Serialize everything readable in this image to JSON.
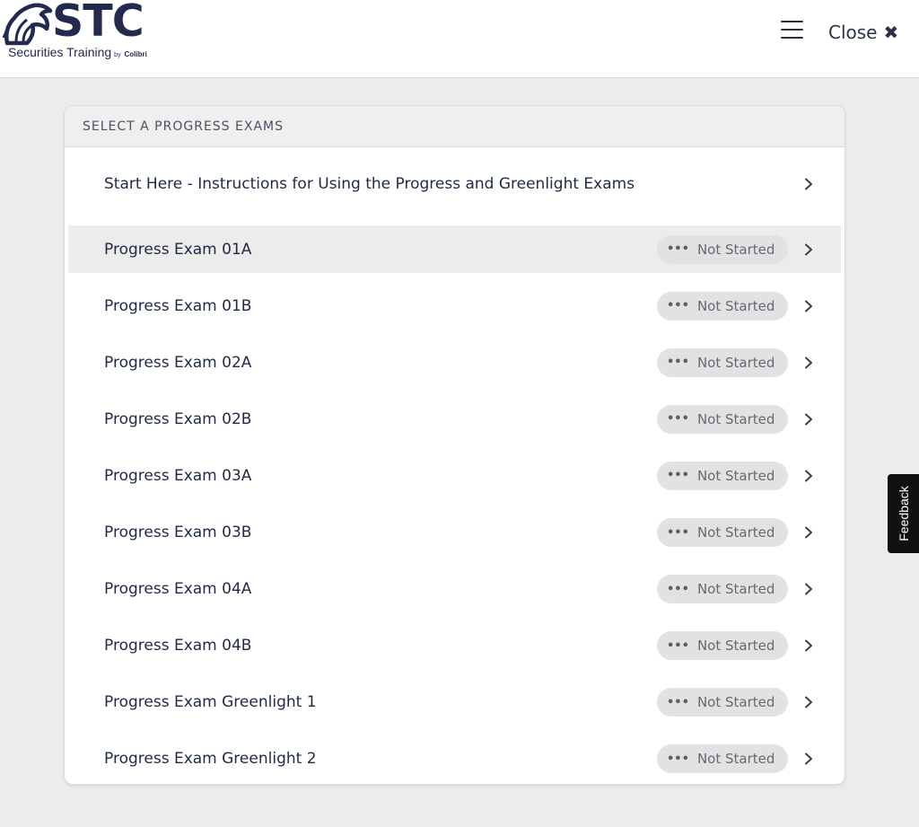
{
  "header": {
    "logo_text": "STC",
    "logo_tagline": "Securities Training",
    "logo_by": "by",
    "logo_brand": "Colibri",
    "menu_icon": "hamburger-menu-icon",
    "close_label": "Close",
    "close_icon": "✖"
  },
  "panel": {
    "title": "SELECT A PROGRESS EXAMS",
    "rows": [
      {
        "title": "Start Here - Instructions for Using the Progress and Greenlight Exams",
        "status": ""
      },
      {
        "title": "Progress Exam 01A",
        "status": "Not Started"
      },
      {
        "title": "Progress Exam 01B",
        "status": "Not Started"
      },
      {
        "title": "Progress Exam 02A",
        "status": "Not Started"
      },
      {
        "title": "Progress Exam 02B",
        "status": "Not Started"
      },
      {
        "title": "Progress Exam 03A",
        "status": "Not Started"
      },
      {
        "title": "Progress Exam 03B",
        "status": "Not Started"
      },
      {
        "title": "Progress Exam 04A",
        "status": "Not Started"
      },
      {
        "title": "Progress Exam 04B",
        "status": "Not Started"
      },
      {
        "title": "Progress Exam Greenlight 1",
        "status": "Not Started"
      },
      {
        "title": "Progress Exam Greenlight 2",
        "status": "Not Started"
      }
    ],
    "status_icon": "•••",
    "highlighted_row": 1
  },
  "feedback": {
    "label": "Feedback"
  },
  "colors": {
    "brand": "#232a4d",
    "page_bg": "#ececec",
    "badge_bg": "#e2e2e2",
    "feedback_bg": "#111111"
  }
}
